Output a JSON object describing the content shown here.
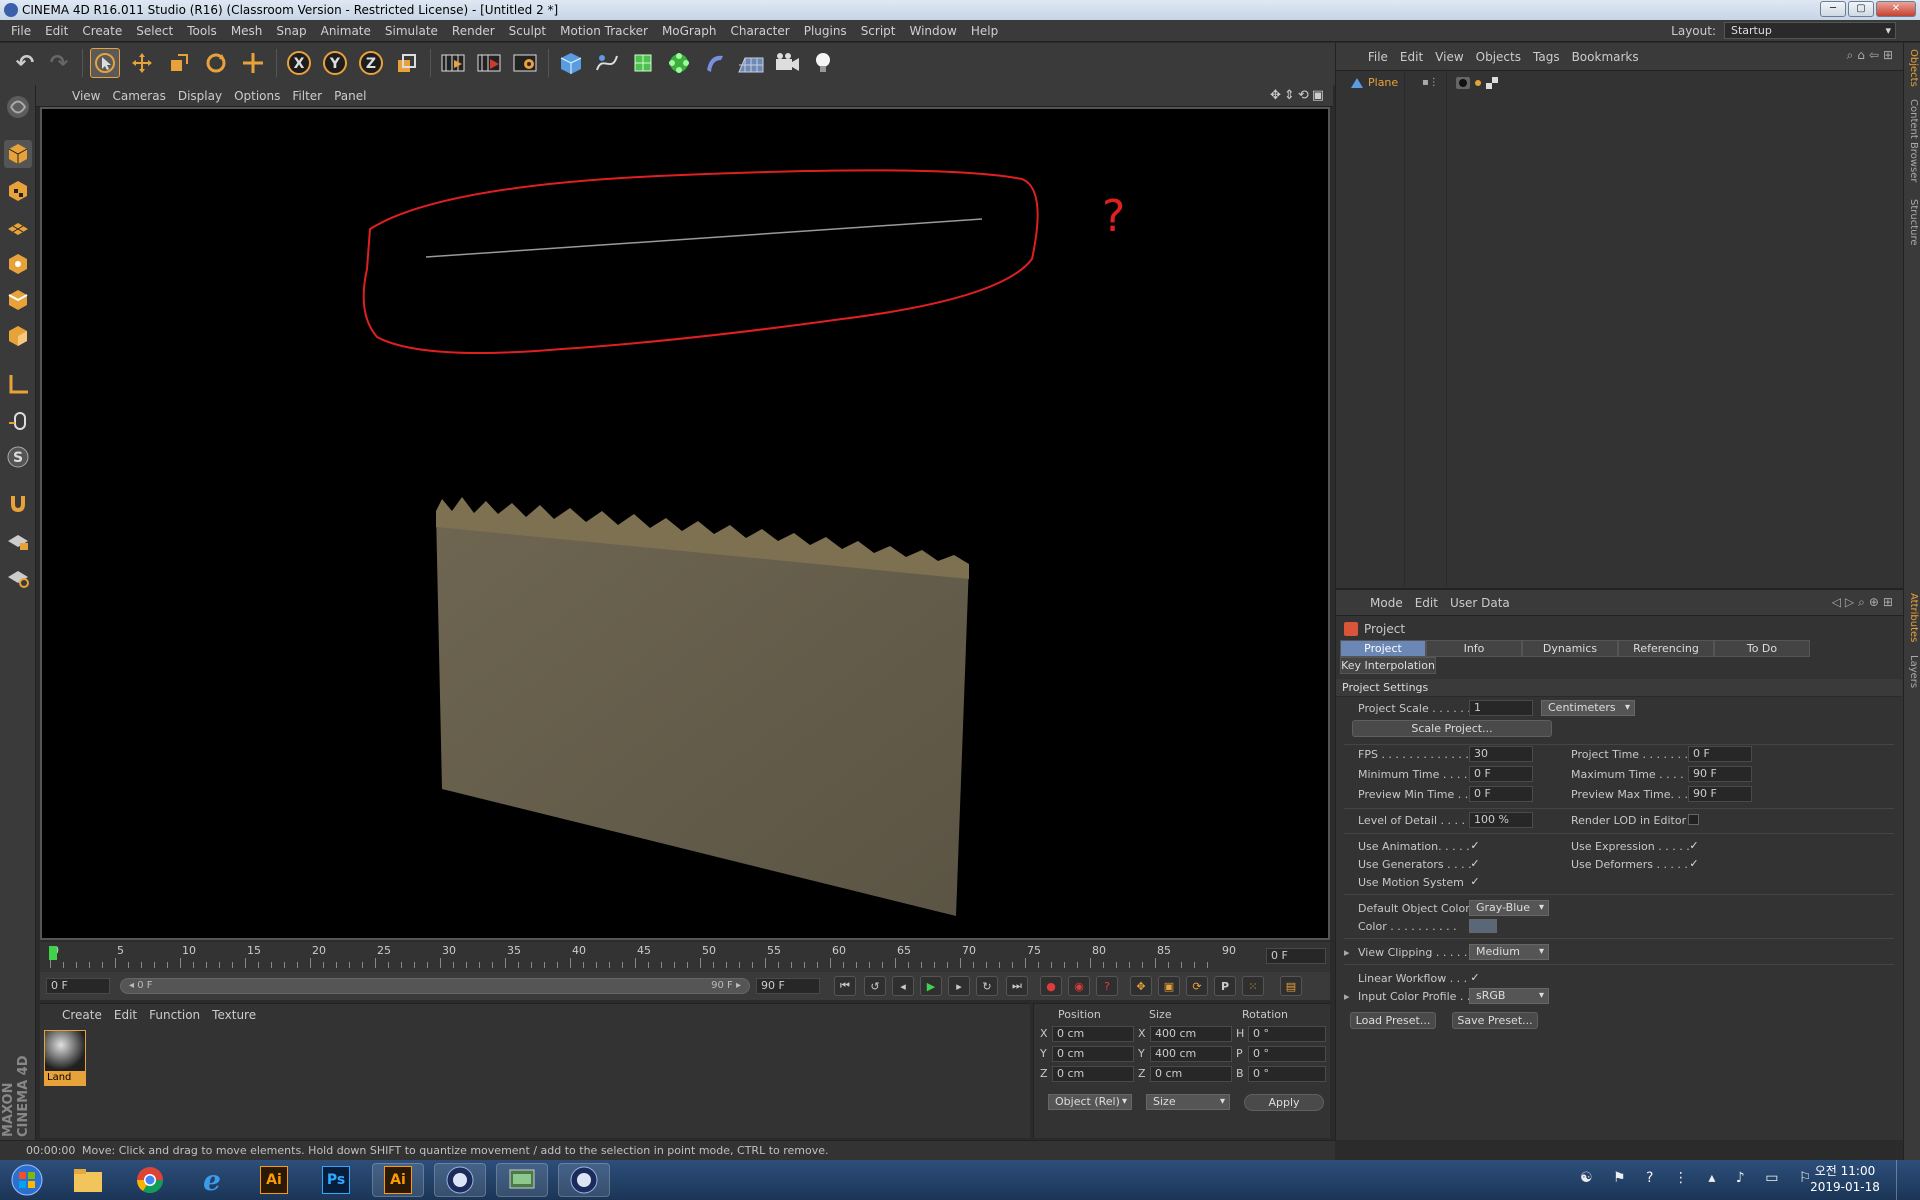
{
  "window": {
    "title": "CINEMA 4D R16.011 Studio (R16) (Classroom Version - Restricted License) - [Untitled 2 *]",
    "layout_label": "Layout:",
    "layout_value": "Startup"
  },
  "menubar": [
    "File",
    "Edit",
    "Create",
    "Select",
    "Tools",
    "Mesh",
    "Snap",
    "Animate",
    "Simulate",
    "Render",
    "Sculpt",
    "Motion Tracker",
    "MoGraph",
    "Character",
    "Plugins",
    "Script",
    "Window",
    "Help"
  ],
  "viewport": {
    "menu": [
      "View",
      "Cameras",
      "Display",
      "Options",
      "Filter",
      "Panel"
    ],
    "annotation_mark": "?"
  },
  "timeline": {
    "ticks": [
      "0",
      "5",
      "10",
      "15",
      "20",
      "25",
      "30",
      "35",
      "40",
      "45",
      "50",
      "55",
      "60",
      "65",
      "70",
      "75",
      "80",
      "85",
      "90"
    ],
    "current_frame": "0 F"
  },
  "transport": {
    "start": "0 F",
    "slider_left": "◂ 0 F",
    "slider_right": "90 F ▸",
    "end": "90 F"
  },
  "material_manager": {
    "menu": [
      "Create",
      "Edit",
      "Function",
      "Texture"
    ],
    "material_name": "Land"
  },
  "coordinates": {
    "headers": [
      "Position",
      "Size",
      "Rotation"
    ],
    "rows": [
      {
        "axis": "X",
        "pos": "0 cm",
        "size_axis": "X",
        "size": "400 cm",
        "rot_axis": "H",
        "rot": "0 °"
      },
      {
        "axis": "Y",
        "pos": "0 cm",
        "size_axis": "Y",
        "size": "400 cm",
        "rot_axis": "P",
        "rot": "0 °"
      },
      {
        "axis": "Z",
        "pos": "0 cm",
        "size_axis": "Z",
        "size": "0 cm",
        "rot_axis": "B",
        "rot": "0 °"
      }
    ],
    "mode_dropdown": "Object (Rel)",
    "size_dropdown": "Size",
    "apply_label": "Apply"
  },
  "status": {
    "time": "00:00:00",
    "message": "Move: Click and drag to move elements. Hold down SHIFT to quantize movement / add to the selection in point mode, CTRL to remove."
  },
  "object_manager": {
    "menu": [
      "File",
      "Edit",
      "View",
      "Objects",
      "Tags",
      "Bookmarks"
    ],
    "objects": [
      {
        "name": "Plane"
      }
    ]
  },
  "attributes": {
    "menu": [
      "Mode",
      "Edit",
      "User Data"
    ],
    "object_title": "Project",
    "tabs": [
      "Project Settings",
      "Info",
      "Dynamics",
      "Referencing",
      "To Do"
    ],
    "tab2": "Key Interpolation",
    "section_title": "Project Settings",
    "project_scale_label": "Project Scale . . . . . .",
    "project_scale_value": "1",
    "project_scale_unit": "Centimeters",
    "scale_project_button": "Scale Project...",
    "fps_label": "FPS . . . . . . . . . . . . . .",
    "fps_value": "30",
    "project_time_label": "Project Time . . . . . . .",
    "project_time_value": "0 F",
    "min_time_label": "Minimum Time . . . .",
    "min_time_value": "0 F",
    "max_time_label": "Maximum Time . . . . .",
    "max_time_value": "90 F",
    "prev_min_label": "Preview Min Time . .",
    "prev_min_value": "0 F",
    "prev_max_label": "Preview Max Time. . .",
    "prev_max_value": "90 F",
    "lod_label": "Level of Detail . . . . .",
    "lod_value": "100 %",
    "render_lod_label": "Render LOD in Editor",
    "use_animation_label": "Use Animation. . . . .",
    "use_expression_label": "Use Expression . . . . .",
    "use_generators_label": "Use Generators . . . .",
    "use_deformers_label": "Use Deformers . . . . .",
    "use_motion_label": "Use Motion System",
    "default_color_label": "Default Object Color",
    "default_color_value": "Gray-Blue",
    "color_label": "Color . . . . . . . . . .",
    "view_clipping_label": "View Clipping . . . . .",
    "view_clipping_value": "Medium",
    "linear_workflow_label": "Linear Workflow . . .",
    "input_color_label": "Input Color Profile . .",
    "input_color_value": "sRGB",
    "load_preset": "Load Preset...",
    "save_preset": "Save Preset...",
    "check": "✓"
  },
  "right_tabs": [
    "Objects",
    "Content Browser",
    "Structure",
    "Attributes",
    "Layers"
  ],
  "taskbar": {
    "clock_time": "오전 11:00",
    "clock_date": "2019-01-18",
    "app_labels": [
      "Ai",
      "Ps",
      "Ai"
    ]
  },
  "brand_vertical": "MAXON CINEMA 4D",
  "colors": {
    "accent_orange": "#e8a23a",
    "selection_blue": "#6a87b5",
    "annotation_red": "#e02020"
  }
}
